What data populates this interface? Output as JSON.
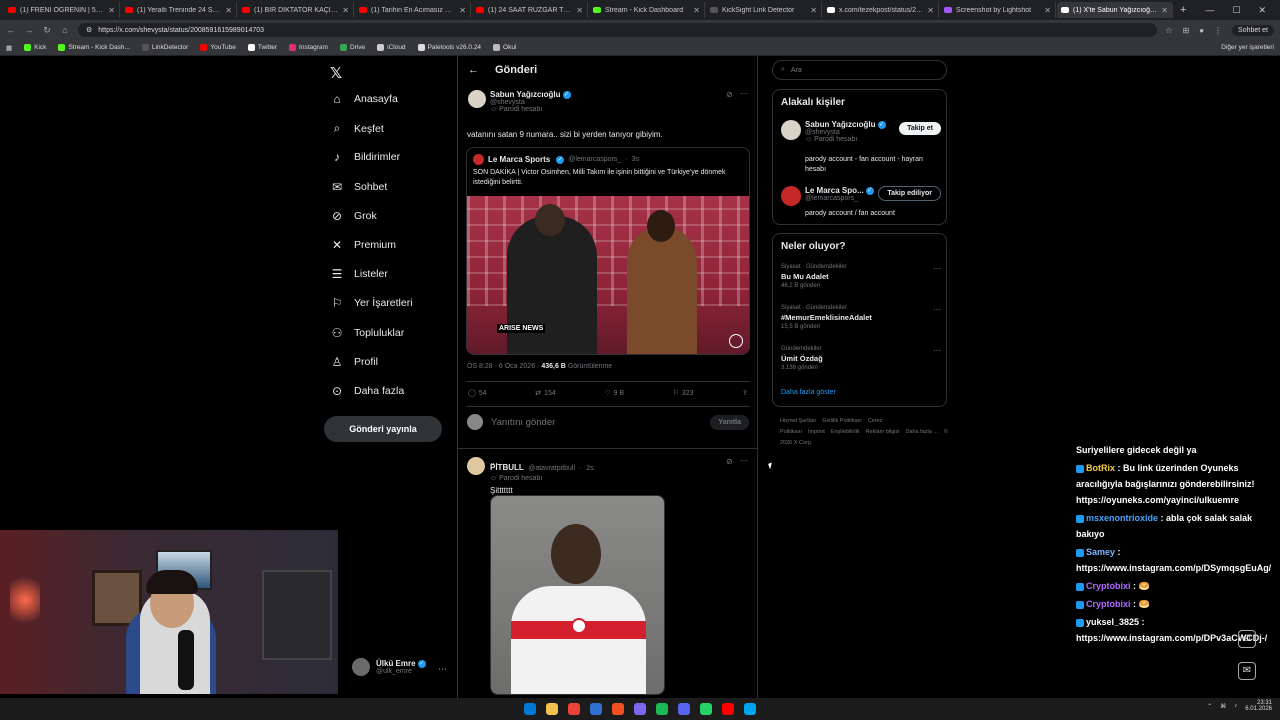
{
  "browser": {
    "tabs": [
      {
        "label": "(1) FRENİ ÖĞRENİN | 5Striders | M",
        "color": "#ff0000"
      },
      {
        "label": "(1) Yeraltı Treninde 24 Saat Hayatt",
        "color": "#ff0000"
      },
      {
        "label": "(1) BİR DİKTATÖR KAÇIRILIRSA NE",
        "color": "#ff0000"
      },
      {
        "label": "(1) Tarihin En Acımasız Diktatör G",
        "color": "#ff0000"
      },
      {
        "label": "(1) 24 SAAT RÜZGAR TÜRBİNİNDE",
        "color": "#ff0000"
      },
      {
        "label": "Stream - Kick Dashboard",
        "color": "#53fc18"
      },
      {
        "label": "KickSight Link Detector",
        "color": "#555555"
      },
      {
        "label": "x.com/tezekpost/status/2008503",
        "color": "#ffffff"
      },
      {
        "label": "Screenshot by Lightshot",
        "color": "#a259ff"
      },
      {
        "label": "(1) X'te Sabun Yağızcıoğlu: \"",
        "color": "#ffffff"
      }
    ],
    "url": "https://x.com/shevysta/status/2008591615989014703",
    "sohbet_label": "Sohbet et",
    "bookmarks": [
      {
        "label": "Kick",
        "color": "#53fc18"
      },
      {
        "label": "Stream - Kick Dash...",
        "color": "#53fc18"
      },
      {
        "label": "LinkDetector",
        "color": "#555555"
      },
      {
        "label": "YouTube",
        "color": "#ff0000"
      },
      {
        "label": "Twitter",
        "color": "#ffffff"
      },
      {
        "label": "Instagram",
        "color": "#e1306c"
      },
      {
        "label": "Drive",
        "color": "#34a853"
      },
      {
        "label": "iCloud",
        "color": "#cccccc"
      },
      {
        "label": "Paletools v26.0.24",
        "color": "#dddddd"
      },
      {
        "label": "Okul",
        "color": "#bbbbbb"
      }
    ],
    "bookmarks_other": "Diğer yer işaretleri"
  },
  "nav": {
    "items": [
      {
        "label": "Anasayfa",
        "icon": "home-icon",
        "glyph": "⌂"
      },
      {
        "label": "Keşfet",
        "icon": "search-icon",
        "glyph": "⌕"
      },
      {
        "label": "Bildirimler",
        "icon": "bell-icon",
        "glyph": "♪"
      },
      {
        "label": "Sohbet",
        "icon": "mail-icon",
        "glyph": "✉"
      },
      {
        "label": "Grok",
        "icon": "grok-icon",
        "glyph": "⊘"
      },
      {
        "label": "Premium",
        "icon": "x-icon",
        "glyph": "✕"
      },
      {
        "label": "Listeler",
        "icon": "list-icon",
        "glyph": "☰"
      },
      {
        "label": "Yer İşaretleri",
        "icon": "bookmark-icon",
        "glyph": "⚐"
      },
      {
        "label": "Topluluklar",
        "icon": "people-icon",
        "glyph": "⚇"
      },
      {
        "label": "Profil",
        "icon": "user-icon",
        "glyph": "♙"
      },
      {
        "label": "Daha fazla",
        "icon": "more-circle-icon",
        "glyph": "⊙"
      }
    ],
    "post_button": "Gönderi yayınla",
    "account": {
      "name": "Ülkü Emre",
      "handle": "@ulk_emre"
    }
  },
  "main": {
    "title": "Gönderi",
    "tweet": {
      "name": "Sabun Yağızcıoğlu",
      "handle": "@shevysta",
      "parody": "Parodi hesabı",
      "text": "vatanını satan 9 numara.. sizi bi yerden tanıyor gibiyim.",
      "quote": {
        "name": "Le Marca Sports",
        "handle": "@lemarcaspors_",
        "time": "3s",
        "text": "SON DAKİKA | Victor Osimhen, Milli Takım ile işinin bittiğini ve Türkiye'ye dönmek istediğini belirtti.",
        "video_brand": "ARISE NEWS"
      },
      "time": "ÖS 8:28 · 6 Oca 2026 ·",
      "views": "436,6 B",
      "views_label": "Görüntülenme",
      "replies": "54",
      "reposts": "154",
      "likes": "9 B",
      "bookmarks": "323"
    },
    "reply_placeholder": "Yanıtını gönder",
    "reply_button": "Yanıtla",
    "reply_tweet": {
      "name": "P̈İTBULL",
      "handle": "@atavratpitbull",
      "time": "2s",
      "parody": "Parodi hesabı",
      "text": "Şittttttt"
    }
  },
  "right": {
    "search_placeholder": "Ara",
    "related_title": "Alakalı kişiler",
    "people": [
      {
        "name": "Sabun Yağızcıoğlu",
        "handle": "@shevysta",
        "parody": "Parodi hesabı",
        "bio": "parody account - fan account - hayran hesabı",
        "button": "Takip et"
      },
      {
        "name": "Le Marca Spo...",
        "handle": "@lemarcaspors_",
        "bio": "parody account / fan account",
        "button": "Takip ediliyor"
      }
    ],
    "trends_title": "Neler oluyor?",
    "trends": [
      {
        "category": "Siyaset · Gündemdekiler",
        "name": "Bu Mu Adalet",
        "count": "46,2 B gönderi"
      },
      {
        "category": "Siyaset · Gündemdekiler",
        "name": "#MemurEmeklisineAdalet",
        "count": "15,5 B gönderi"
      },
      {
        "category": "Gündemdekiler",
        "name": "Ümit Özdağ",
        "count": "3.138 gönderi"
      }
    ],
    "show_more": "Daha fazla göster",
    "footer": [
      "Hizmet Şartları",
      "Gizlilik Politikası",
      "Çerez Politikası",
      "İmprint",
      "Erişilebilirlik",
      "Reklam bilgisi",
      "Daha fazla ...",
      "© 2026 X Corp."
    ]
  },
  "stream": {
    "chat_header": "Suriyelilere gidecek değil ya",
    "messages": [
      {
        "user": "BotRix",
        "cls": "u-botrix",
        "text": "Bu link üzerinden Oyuneks aracılığıyla bağışlarınızı gönderebilirsiniz! https://oyuneks.com/yayinci/ulkuemre"
      },
      {
        "user": "msxenontrioxide",
        "cls": "u-msx",
        "text": "abla çok salak salak bakıyo"
      },
      {
        "user": "Samey",
        "cls": "u-sam",
        "text": "https://www.instagram.com/p/DSymqsgEuAg/"
      },
      {
        "user": "Cryptobixi",
        "cls": "u-crypto",
        "text": "🥯"
      },
      {
        "user": "Cryptobixi",
        "cls": "u-crypto",
        "text": "🥯"
      },
      {
        "user": "yuksel_3825",
        "cls": "u-yuk",
        "text": "https://www.instagram.com/p/DPv3aCWCDj-/"
      }
    ]
  },
  "taskbar": {
    "time": "23:31",
    "date": "6.01.2026",
    "apps": [
      "#0078d4",
      "#f2c14e",
      "#ea4335",
      "#2f6fd0",
      "#f25022",
      "#7b68ee",
      "#1db954",
      "#5865f2",
      "#25d366",
      "#ff0000",
      "#00a4ef"
    ]
  }
}
